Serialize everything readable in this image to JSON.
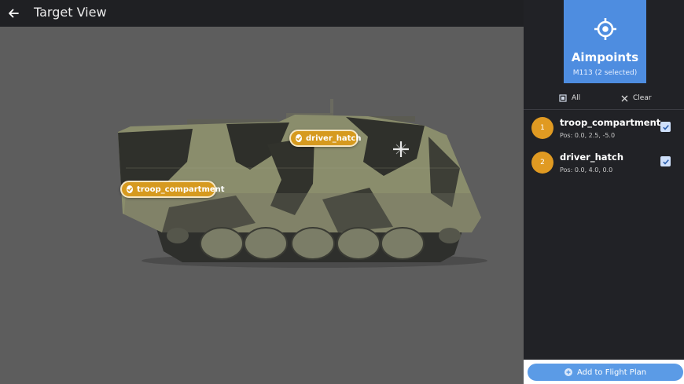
{
  "header": {
    "title": "Target View",
    "back_icon": "arrow-left-icon"
  },
  "viewport": {
    "labels": [
      {
        "text": "driver_hatch",
        "icon": "check-circle-icon"
      },
      {
        "text": "troop_compartment",
        "icon": "check-circle-icon"
      }
    ],
    "accent_color": "#d69a1f"
  },
  "panel": {
    "icon": "crosshair-icon",
    "title": "Aimpoints",
    "subtitle": "M113 (2 selected)",
    "select_all_label": "All",
    "clear_label": "Clear",
    "items": [
      {
        "number": "1",
        "name": "troop_compartment",
        "pos": "Pos: 0.0, 2.5, -5.0",
        "checked": true
      },
      {
        "number": "2",
        "name": "driver_hatch",
        "pos": "Pos: 0.0, 4.0, 0.0",
        "checked": true
      }
    ],
    "add_button_label": "Add to Flight Plan",
    "header_color": "#4e8de0"
  }
}
